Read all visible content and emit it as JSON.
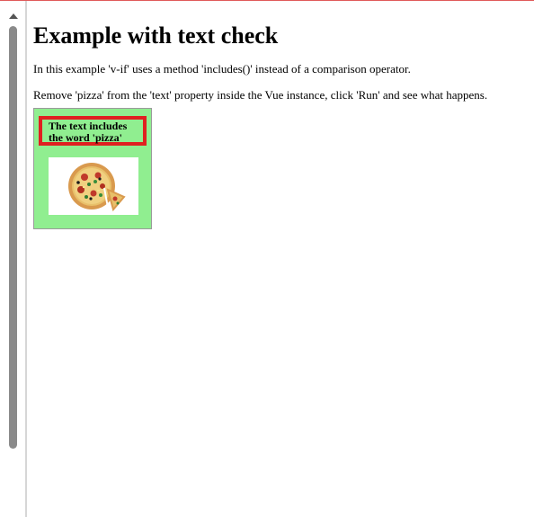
{
  "page": {
    "title": "Example with text check",
    "paragraph1": "In this example 'v-if' uses a method 'includes()' instead of a comparison operator.",
    "paragraph2": "Remove 'pizza' from the 'text' property inside the Vue instance, click 'Run' and see what happens."
  },
  "app": {
    "message_line1": "The text includes",
    "message_line2": "the word 'pizza'",
    "image_icon": "pizza-icon"
  },
  "colors": {
    "app_background": "#90ee90",
    "highlight_border": "#e02020"
  }
}
